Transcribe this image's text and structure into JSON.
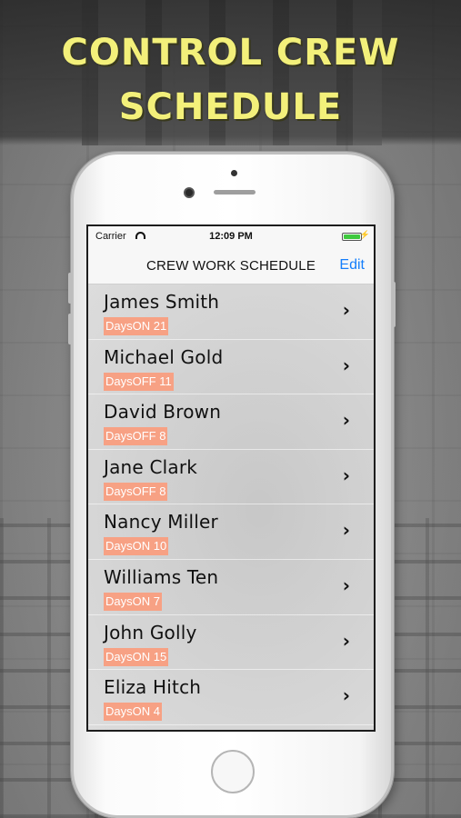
{
  "headline": {
    "line1": "CONTROL CREW",
    "line2": "SCHEDULE"
  },
  "status_bar": {
    "carrier": "Carrier",
    "time": "12:09 PM",
    "battery_icon": "battery-charging-icon",
    "wifi_icon": "wifi-icon"
  },
  "nav": {
    "title": "CREW WORK SCHEDULE",
    "edit_label": "Edit"
  },
  "colors": {
    "headline": "#f3f07a",
    "badge": "#f7a184",
    "edit": "#147efb"
  },
  "crew": [
    {
      "name": "James Smith",
      "status": "DaysON 21"
    },
    {
      "name": "Michael Gold",
      "status": "DaysOFF 11"
    },
    {
      "name": "David Brown",
      "status": "DaysOFF 8"
    },
    {
      "name": "Jane Clark",
      "status": "DaysOFF 8"
    },
    {
      "name": "Nancy Miller",
      "status": "DaysON 10"
    },
    {
      "name": "Williams Ten",
      "status": "DaysON 7"
    },
    {
      "name": "John Golly",
      "status": "DaysON 15"
    },
    {
      "name": "Eliza Hitch",
      "status": "DaysON 4"
    }
  ]
}
